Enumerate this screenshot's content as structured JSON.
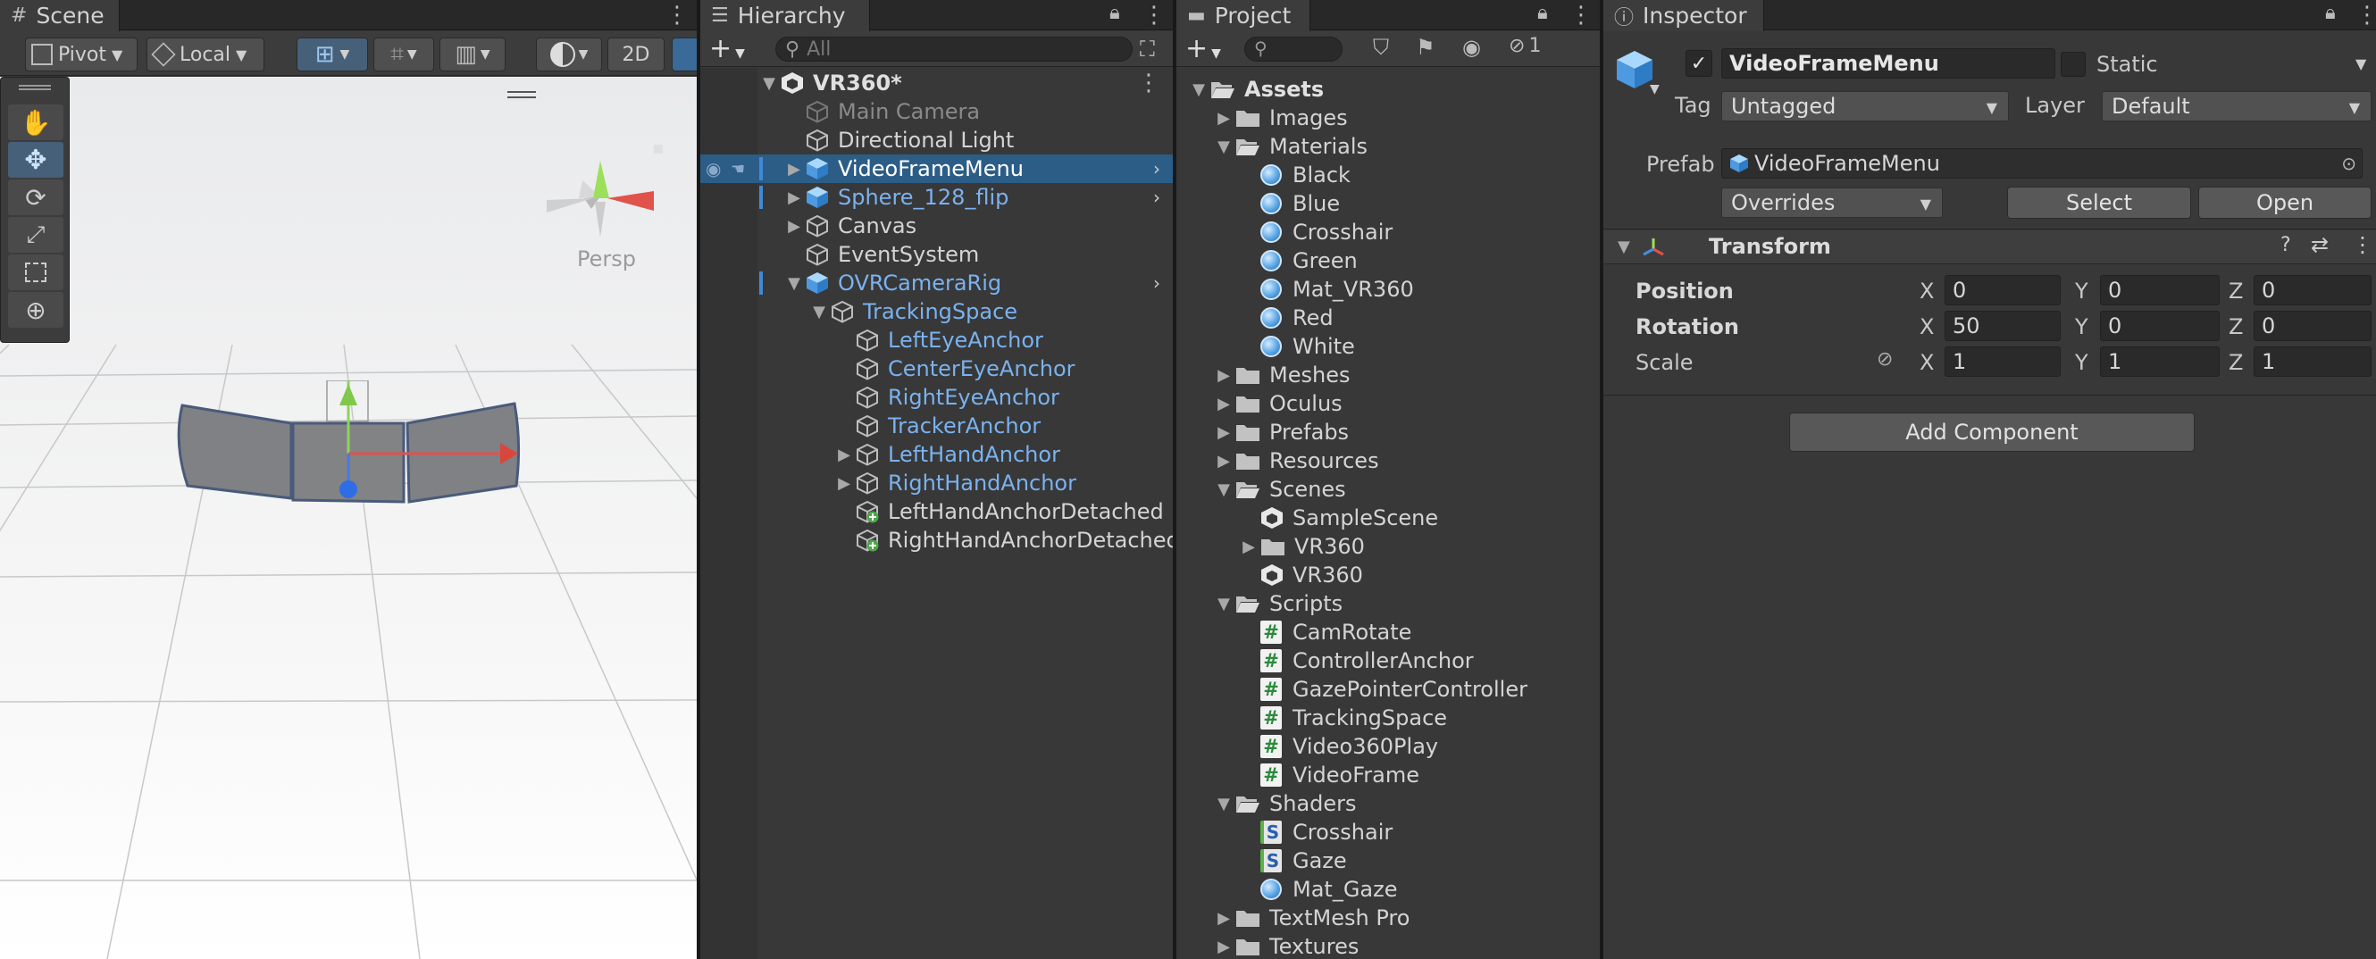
{
  "scene": {
    "tab_label": "Scene",
    "pivot_label": "Pivot",
    "local_label": "Local",
    "mode_2d_label": "2D",
    "persp_label": "Persp"
  },
  "hierarchy": {
    "tab_label": "Hierarchy",
    "search_placeholder": "All",
    "root_label": "VR360*",
    "items": [
      {
        "label": "Main Camera",
        "style": "dim",
        "depth": 1,
        "arrow": "",
        "icon": "cube-outline"
      },
      {
        "label": "Directional Light",
        "style": "norm",
        "depth": 1,
        "arrow": "",
        "icon": "cube-outline"
      },
      {
        "label": "VideoFrameMenu",
        "style": "selected",
        "depth": 1,
        "arrow": "▶",
        "icon": "cube-blue",
        "more": true
      },
      {
        "label": "Sphere_128_flip",
        "style": "blue",
        "depth": 1,
        "arrow": "▶",
        "icon": "cube-blue",
        "more": true
      },
      {
        "label": "Canvas",
        "style": "norm",
        "depth": 1,
        "arrow": "▶",
        "icon": "cube-outline"
      },
      {
        "label": "EventSystem",
        "style": "norm",
        "depth": 1,
        "arrow": "",
        "icon": "cube-outline"
      },
      {
        "label": "OVRCameraRig",
        "style": "blue",
        "depth": 1,
        "arrow": "▼",
        "icon": "cube-blue",
        "more": true
      },
      {
        "label": "TrackingSpace",
        "style": "blue",
        "depth": 2,
        "arrow": "▼",
        "icon": "cube-outline"
      },
      {
        "label": "LeftEyeAnchor",
        "style": "blue",
        "depth": 3,
        "arrow": "",
        "icon": "cube-outline"
      },
      {
        "label": "CenterEyeAnchor",
        "style": "blue",
        "depth": 3,
        "arrow": "",
        "icon": "cube-outline"
      },
      {
        "label": "RightEyeAnchor",
        "style": "blue",
        "depth": 3,
        "arrow": "",
        "icon": "cube-outline"
      },
      {
        "label": "TrackerAnchor",
        "style": "blue",
        "depth": 3,
        "arrow": "",
        "icon": "cube-outline"
      },
      {
        "label": "LeftHandAnchor",
        "style": "blue",
        "depth": 3,
        "arrow": "▶",
        "icon": "cube-outline"
      },
      {
        "label": "RightHandAnchor",
        "style": "blue",
        "depth": 3,
        "arrow": "▶",
        "icon": "cube-outline"
      },
      {
        "label": "LeftHandAnchorDetached",
        "style": "norm",
        "depth": 3,
        "arrow": "",
        "icon": "cube-add"
      },
      {
        "label": "RightHandAnchorDetached",
        "style": "norm",
        "depth": 3,
        "arrow": "",
        "icon": "cube-add"
      }
    ]
  },
  "project": {
    "tab_label": "Project",
    "hidden_count": "1",
    "items": [
      {
        "label": "Assets",
        "type": "folder-open",
        "depth": 0,
        "arrow": "▼",
        "bold": true
      },
      {
        "label": "Images",
        "type": "folder",
        "depth": 1,
        "arrow": "▶"
      },
      {
        "label": "Materials",
        "type": "folder-open",
        "depth": 1,
        "arrow": "▼"
      },
      {
        "label": "Black",
        "type": "material",
        "depth": 2,
        "arrow": ""
      },
      {
        "label": "Blue",
        "type": "material",
        "depth": 2,
        "arrow": ""
      },
      {
        "label": "Crosshair",
        "type": "material",
        "depth": 2,
        "arrow": ""
      },
      {
        "label": "Green",
        "type": "material",
        "depth": 2,
        "arrow": ""
      },
      {
        "label": "Mat_VR360",
        "type": "material",
        "depth": 2,
        "arrow": ""
      },
      {
        "label": "Red",
        "type": "material",
        "depth": 2,
        "arrow": ""
      },
      {
        "label": "White",
        "type": "material",
        "depth": 2,
        "arrow": ""
      },
      {
        "label": "Meshes",
        "type": "folder",
        "depth": 1,
        "arrow": "▶"
      },
      {
        "label": "Oculus",
        "type": "folder",
        "depth": 1,
        "arrow": "▶"
      },
      {
        "label": "Prefabs",
        "type": "folder",
        "depth": 1,
        "arrow": "▶"
      },
      {
        "label": "Resources",
        "type": "folder",
        "depth": 1,
        "arrow": "▶"
      },
      {
        "label": "Scenes",
        "type": "folder-open",
        "depth": 1,
        "arrow": "▼"
      },
      {
        "label": "SampleScene",
        "type": "scene",
        "depth": 2,
        "arrow": ""
      },
      {
        "label": "VR360",
        "type": "folder",
        "depth": 2,
        "arrow": "▶"
      },
      {
        "label": "VR360",
        "type": "scene",
        "depth": 2,
        "arrow": ""
      },
      {
        "label": "Scripts",
        "type": "folder-open",
        "depth": 1,
        "arrow": "▼"
      },
      {
        "label": "CamRotate",
        "type": "script",
        "depth": 2,
        "arrow": ""
      },
      {
        "label": "ControllerAnchor",
        "type": "script",
        "depth": 2,
        "arrow": ""
      },
      {
        "label": "GazePointerController",
        "type": "script",
        "depth": 2,
        "arrow": ""
      },
      {
        "label": "TrackingSpace",
        "type": "script",
        "depth": 2,
        "arrow": ""
      },
      {
        "label": "Video360Play",
        "type": "script",
        "depth": 2,
        "arrow": ""
      },
      {
        "label": "VideoFrame",
        "type": "script",
        "depth": 2,
        "arrow": ""
      },
      {
        "label": "Shaders",
        "type": "folder-open",
        "depth": 1,
        "arrow": "▼"
      },
      {
        "label": "Crosshair",
        "type": "shader",
        "depth": 2,
        "arrow": ""
      },
      {
        "label": "Gaze",
        "type": "shader",
        "depth": 2,
        "arrow": ""
      },
      {
        "label": "Mat_Gaze",
        "type": "material",
        "depth": 2,
        "arrow": ""
      },
      {
        "label": "TextMesh Pro",
        "type": "folder",
        "depth": 1,
        "arrow": "▶"
      },
      {
        "label": "Textures",
        "type": "folder",
        "depth": 1,
        "arrow": "▶"
      }
    ]
  },
  "inspector": {
    "tab_label": "Inspector",
    "object_name": "VideoFrameMenu",
    "static_label": "Static",
    "tag_label": "Tag",
    "tag_value": "Untagged",
    "layer_label": "Layer",
    "layer_value": "Default",
    "prefab_label": "Prefab",
    "prefab_value": "VideoFrameMenu",
    "overrides_label": "Overrides",
    "select_label": "Select",
    "open_label": "Open",
    "transform_label": "Transform",
    "position_label": "Position",
    "rotation_label": "Rotation",
    "scale_label": "Scale",
    "axis_x": "X",
    "axis_y": "Y",
    "axis_z": "Z",
    "position": {
      "x": "0",
      "y": "0",
      "z": "0"
    },
    "rotation": {
      "x": "50",
      "y": "0",
      "z": "0"
    },
    "scale": {
      "x": "1",
      "y": "1",
      "z": "1"
    },
    "add_component_label": "Add Component"
  },
  "colors": {
    "selection": "#2c5d87",
    "prefab_blue": "#7ab2f0",
    "panel_bg": "#383838"
  }
}
